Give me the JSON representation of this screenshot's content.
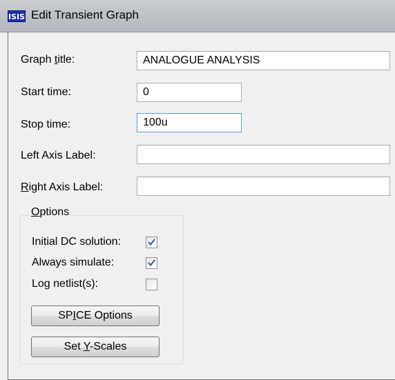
{
  "window": {
    "title": "Edit Transient Graph",
    "icon": "isis-app-icon"
  },
  "form": {
    "graph_title": {
      "label_pre": "Graph ",
      "label_accel": "t",
      "label_post": "itle:",
      "value": "ANALOGUE ANALYSIS"
    },
    "start_time": {
      "label": "Start time:",
      "value": "0"
    },
    "stop_time": {
      "label": "Stop time:",
      "value": "100u"
    },
    "left_axis_label": {
      "label": "Left Axis Label:",
      "value": ""
    },
    "right_axis_label": {
      "label_accel": "R",
      "label_post": "ight Axis Label:",
      "value": ""
    }
  },
  "options": {
    "legend_accel": "O",
    "legend_post": "ptions",
    "initial_dc": {
      "label": "Initial DC solution:",
      "checked": true
    },
    "always_simulate": {
      "label": "Always simulate:",
      "checked": true
    },
    "log_netlists": {
      "label": "Log netlist(s):",
      "checked": false
    },
    "spice_button": {
      "pre": "SP",
      "accel": "I",
      "post": "CE Options"
    },
    "yscales_button": {
      "pre": "Set ",
      "accel": "Y",
      "post": "-Scales"
    }
  },
  "colors": {
    "check_mark": "#4a5e9a",
    "icon_bg": "#1c2ea8"
  }
}
